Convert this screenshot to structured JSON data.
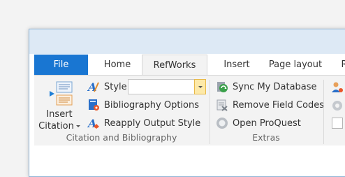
{
  "tabs": {
    "file": "File",
    "home": "Home",
    "refworks": "RefWorks",
    "insert": "Insert",
    "page_layout": "Page layout",
    "partial": "R"
  },
  "citation_group": {
    "insert_citation_line1": "Insert",
    "insert_citation_line2": "Citation",
    "style_label": "Style:",
    "style_value": "",
    "bibliography_options": "Bibliography Options",
    "reapply_output_style": "Reapply Output Style",
    "group_label": "Citation and Bibliography"
  },
  "extras_group": {
    "sync_database": "Sync My Database",
    "remove_field_codes": "Remove Field Codes",
    "open_proquest": "Open ProQuest",
    "group_label": "Extras"
  },
  "colors": {
    "file_tab": "#1976d2",
    "ribbon_bg": "#f3f3f3",
    "titlebar": "#dde9f5",
    "dropdown_accent": "#fde9a8"
  }
}
